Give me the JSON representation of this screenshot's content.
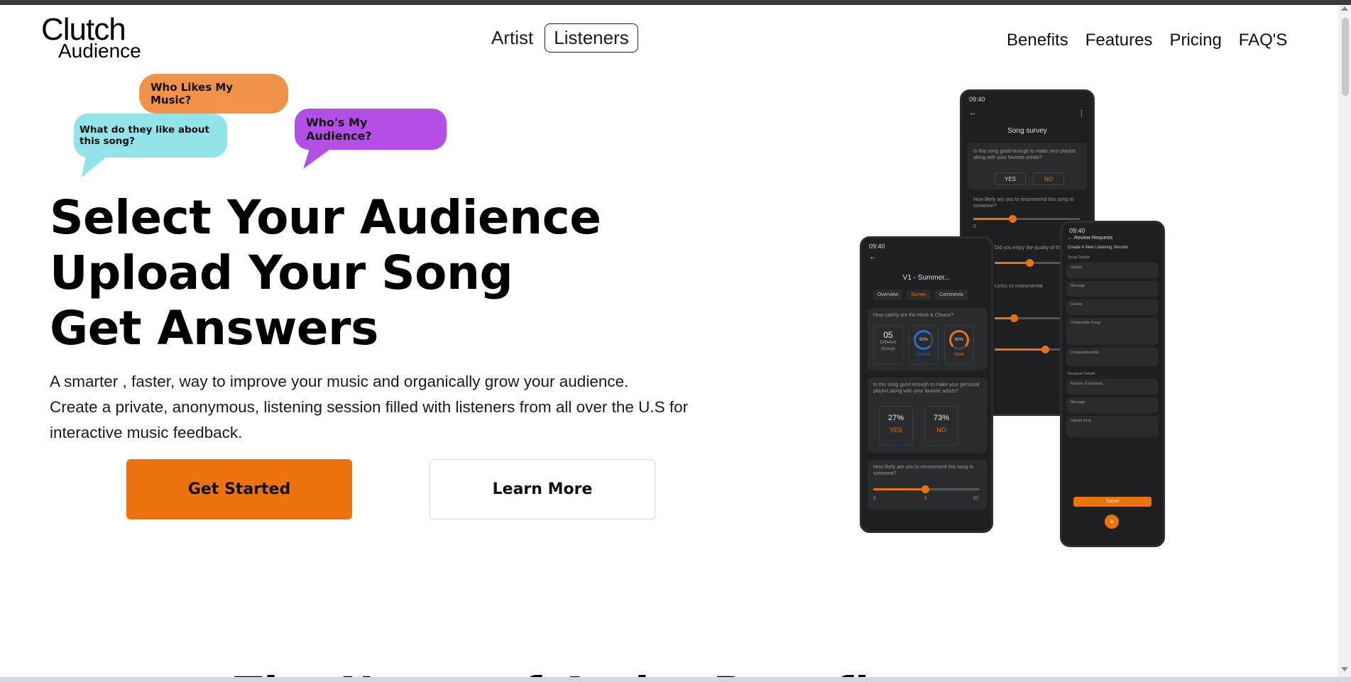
{
  "brand": {
    "line1": "Clutch",
    "line2": "Audience"
  },
  "center_nav": {
    "artist": "Artist",
    "listeners": "Listeners"
  },
  "right_nav": [
    "Benefits",
    "Features",
    "Pricing",
    "FAQ'S"
  ],
  "bubbles": {
    "b1": "Who Likes My Music?",
    "b2": "What do they like about this song?",
    "b3": "Who's My Audience?"
  },
  "hero": {
    "line1": "Select Your Audience",
    "line2": "Upload Your Song",
    "line3": "Get Answers",
    "sub1": "A smarter , faster, way to improve your music and organically grow your audience.",
    "sub2": "Create a private, anonymous, listening session filled with listeners from all over the U.S for interactive music feedback."
  },
  "buttons": {
    "primary": "Get Started",
    "secondary": "Learn More"
  },
  "phone_survey": {
    "time": "09:40",
    "title": "Song survey",
    "q1": "Is this song good enough to make your playlist along with your favorite artists?",
    "yes": "YES",
    "no": "NO",
    "q2": "How likely are you to recommend this song to someone?",
    "q3": "Did you enjoy the quality of the song?",
    "q4": "Lyrics vs Instrumental",
    "slider_min": "0"
  },
  "phone_stats": {
    "time": "09:40",
    "title": "V1 - Summer...",
    "tabs": [
      "Overview",
      "Survey",
      "Comments"
    ],
    "q1": "How catchy are the Hook & Chorus?",
    "groups_value": "05",
    "groups_label": "Different Groups",
    "chorus_pct": "50%",
    "chorus_label": "Chorus",
    "hook_pct": "60%",
    "hook_label": "Hook",
    "q2": "Is this song good enough to make your personal playlist along with your favorite artists?",
    "yes_pct": "27%",
    "yes": "YES",
    "no_pct": "73%",
    "no": "NO",
    "q3": "How likely are you to recommend this song to someone?",
    "slider_min": "0",
    "slider_mid": "6",
    "slider_max": "10"
  },
  "phone_review": {
    "time": "09:40",
    "title": "Review Requests",
    "subtitle": "Create A New Listening Session",
    "section1": "Song Details",
    "fields": [
      "Genres",
      "Message",
      "Creator",
      "Comparable Songs",
      "Comparable Artist"
    ],
    "section2": "Request Details",
    "fields2": [
      "Number of Sessions",
      "Message",
      "Upload Song"
    ],
    "submit": "Submit"
  },
  "next_section_peek": "The Name of Artist Benefits",
  "colors": {
    "accent": "#ec720d",
    "bubble_orange": "#f0924a",
    "bubble_cyan": "#93e4e8",
    "bubble_purple": "#b34ee6"
  }
}
